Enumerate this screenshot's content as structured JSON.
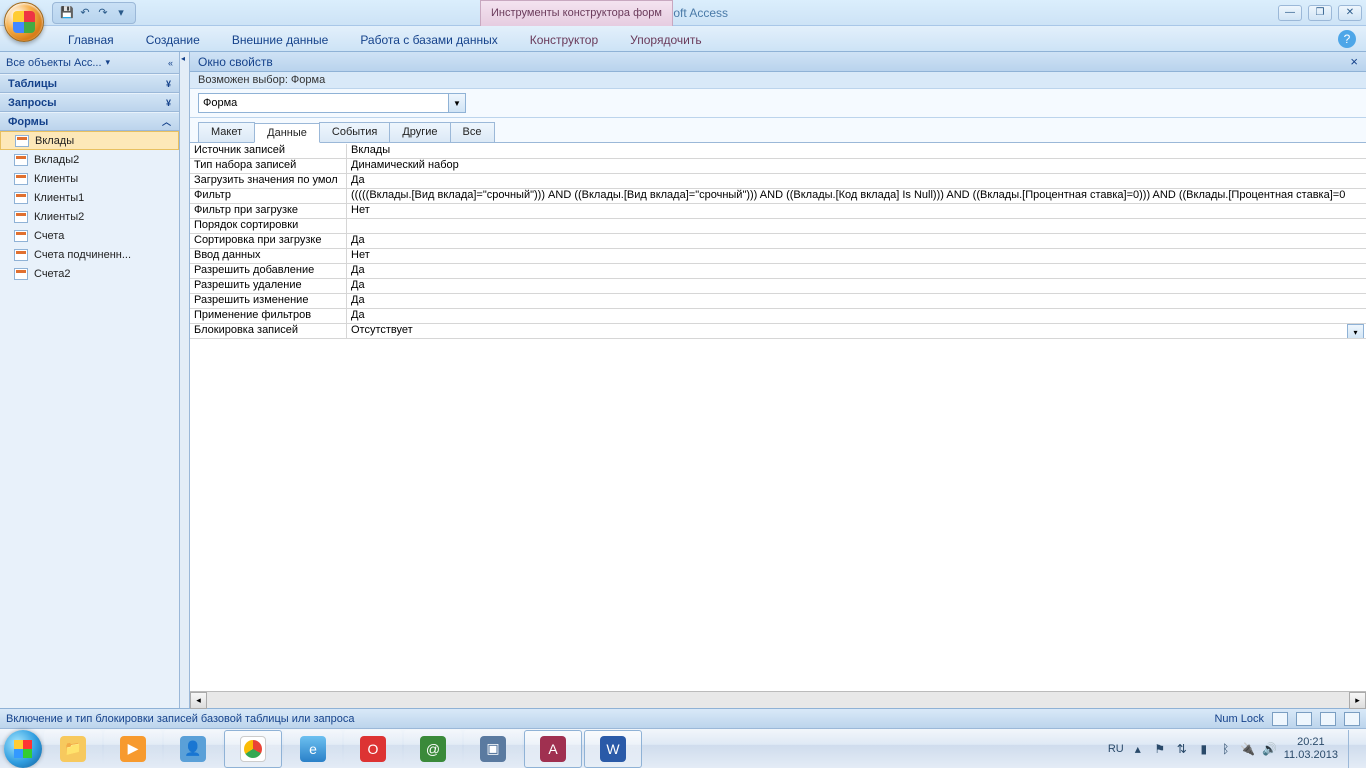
{
  "title": {
    "app": "Microsoft Access",
    "context_tab": "Инструменты конструктора форм"
  },
  "ribbon": {
    "tabs": [
      "Главная",
      "Создание",
      "Внешние данные",
      "Работа с базами данных",
      "Конструктор",
      "Упорядочить"
    ]
  },
  "navpane": {
    "header": "Все объекты Acc...",
    "groups": {
      "tables": "Таблицы",
      "queries": "Запросы",
      "forms": "Формы"
    },
    "forms": [
      "Вклады",
      "Вклады2",
      "Клиенты",
      "Клиенты1",
      "Клиенты2",
      "Счета",
      "Счета подчиненн...",
      "Счета2"
    ]
  },
  "propsheet": {
    "title": "Окно свойств",
    "subtitle": "Возможен выбор:   Форма",
    "selector": "Форма",
    "tabs": [
      "Макет",
      "Данные",
      "События",
      "Другие",
      "Все"
    ],
    "active_tab": "Данные",
    "rows": [
      {
        "name": "Источник записей",
        "value": "Вклады"
      },
      {
        "name": "Тип набора записей",
        "value": "Динамический набор"
      },
      {
        "name": "Загрузить значения по умол",
        "value": "Да"
      },
      {
        "name": "Фильтр",
        "value": "(((((Вклады.[Вид вклада]=\"срочный\"))) AND ((Вклады.[Вид вклада]=\"срочный\"))) AND ((Вклады.[Код вклада] Is Null))) AND ((Вклады.[Процентная ставка]=0))) AND ((Вклады.[Процентная ставка]=0"
      },
      {
        "name": "Фильтр при загрузке",
        "value": "Нет"
      },
      {
        "name": "Порядок сортировки",
        "value": ""
      },
      {
        "name": "Сортировка при загрузке",
        "value": "Да"
      },
      {
        "name": "Ввод данных",
        "value": "Нет"
      },
      {
        "name": "Разрешить добавление",
        "value": "Да"
      },
      {
        "name": "Разрешить удаление",
        "value": "Да"
      },
      {
        "name": "Разрешить изменение",
        "value": "Да"
      },
      {
        "name": "Применение фильтров",
        "value": "Да"
      },
      {
        "name": "Блокировка записей",
        "value": "Отсутствует"
      }
    ]
  },
  "statusbar": {
    "message": "Включение и тип блокировки записей базовой таблицы или запроса",
    "numlock": "Num Lock"
  },
  "tray": {
    "lang": "RU",
    "time": "20:21",
    "date": "11.03.2013"
  }
}
